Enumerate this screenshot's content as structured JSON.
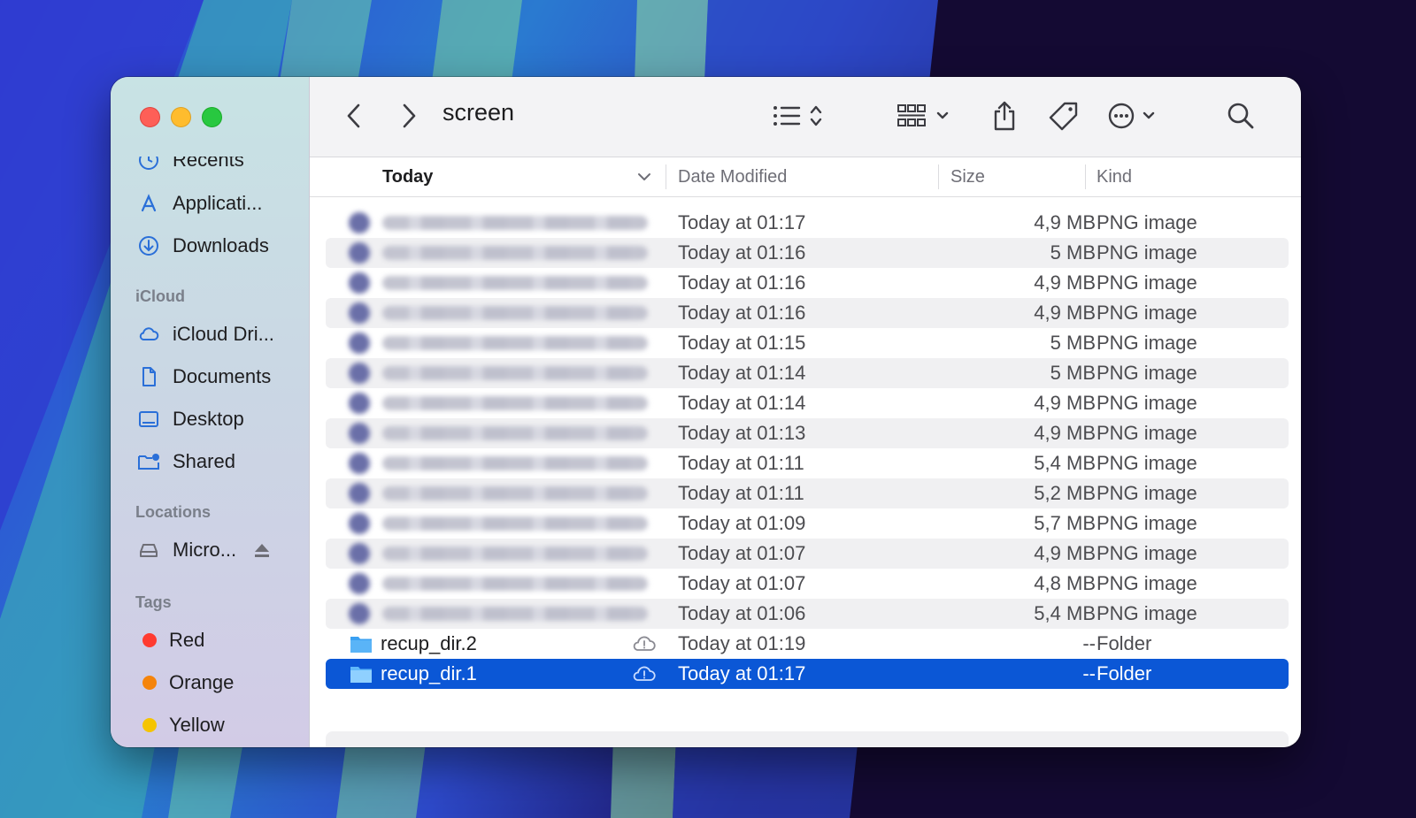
{
  "window": {
    "title": "screen",
    "traffic_lights": [
      "close",
      "minimize",
      "zoom"
    ]
  },
  "sidebar": {
    "favorites": [
      {
        "label": "Recents",
        "icon": "clock-icon"
      },
      {
        "label": "Applicati...",
        "icon": "applications-icon"
      },
      {
        "label": "Downloads",
        "icon": "downloads-icon"
      }
    ],
    "icloud_heading": "iCloud",
    "icloud": [
      {
        "label": "iCloud Dri...",
        "icon": "cloud-icon"
      },
      {
        "label": "Documents",
        "icon": "document-icon"
      },
      {
        "label": "Desktop",
        "icon": "desktop-icon"
      },
      {
        "label": "Shared",
        "icon": "shared-folder-icon"
      }
    ],
    "locations_heading": "Locations",
    "locations": [
      {
        "label": "Micro...",
        "icon": "drive-icon",
        "eject": true
      }
    ],
    "tags_heading": "Tags",
    "tags": [
      {
        "label": "Red",
        "color": "#ff3b30"
      },
      {
        "label": "Orange",
        "color": "#f5840b"
      },
      {
        "label": "Yellow",
        "color": "#f5c400"
      }
    ]
  },
  "toolbar": {
    "back": "chevron-left-icon",
    "forward": "chevron-right-icon",
    "view": "list-view-icon",
    "group": "grid-icon",
    "share": "share-icon",
    "tag": "tag-icon",
    "more": "ellipsis-circle-icon",
    "search": "search-icon"
  },
  "columns": {
    "name": "Today",
    "date": "Date Modified",
    "size": "Size",
    "kind": "Kind"
  },
  "files": [
    {
      "date": "Today at 01:17",
      "size": "4,9 MB",
      "kind": "PNG image"
    },
    {
      "date": "Today at 01:16",
      "size": "5 MB",
      "kind": "PNG image"
    },
    {
      "date": "Today at 01:16",
      "size": "4,9 MB",
      "kind": "PNG image"
    },
    {
      "date": "Today at 01:16",
      "size": "4,9 MB",
      "kind": "PNG image"
    },
    {
      "date": "Today at 01:15",
      "size": "5 MB",
      "kind": "PNG image"
    },
    {
      "date": "Today at 01:14",
      "size": "5 MB",
      "kind": "PNG image"
    },
    {
      "date": "Today at 01:14",
      "size": "4,9 MB",
      "kind": "PNG image"
    },
    {
      "date": "Today at 01:13",
      "size": "4,9 MB",
      "kind": "PNG image"
    },
    {
      "date": "Today at 01:11",
      "size": "5,4 MB",
      "kind": "PNG image"
    },
    {
      "date": "Today at 01:11",
      "size": "5,2 MB",
      "kind": "PNG image"
    },
    {
      "date": "Today at 01:09",
      "size": "5,7 MB",
      "kind": "PNG image"
    },
    {
      "date": "Today at 01:07",
      "size": "4,9 MB",
      "kind": "PNG image"
    },
    {
      "date": "Today at 01:07",
      "size": "4,8 MB",
      "kind": "PNG image"
    },
    {
      "date": "Today at 01:06",
      "size": "5,4 MB",
      "kind": "PNG image"
    }
  ],
  "folders": [
    {
      "name": "recup_dir.2",
      "date": "Today at 01:19",
      "size": "--",
      "kind": "Folder",
      "selected": false
    },
    {
      "name": "recup_dir.1",
      "date": "Today at 01:17",
      "size": "--",
      "kind": "Folder",
      "selected": true
    }
  ]
}
